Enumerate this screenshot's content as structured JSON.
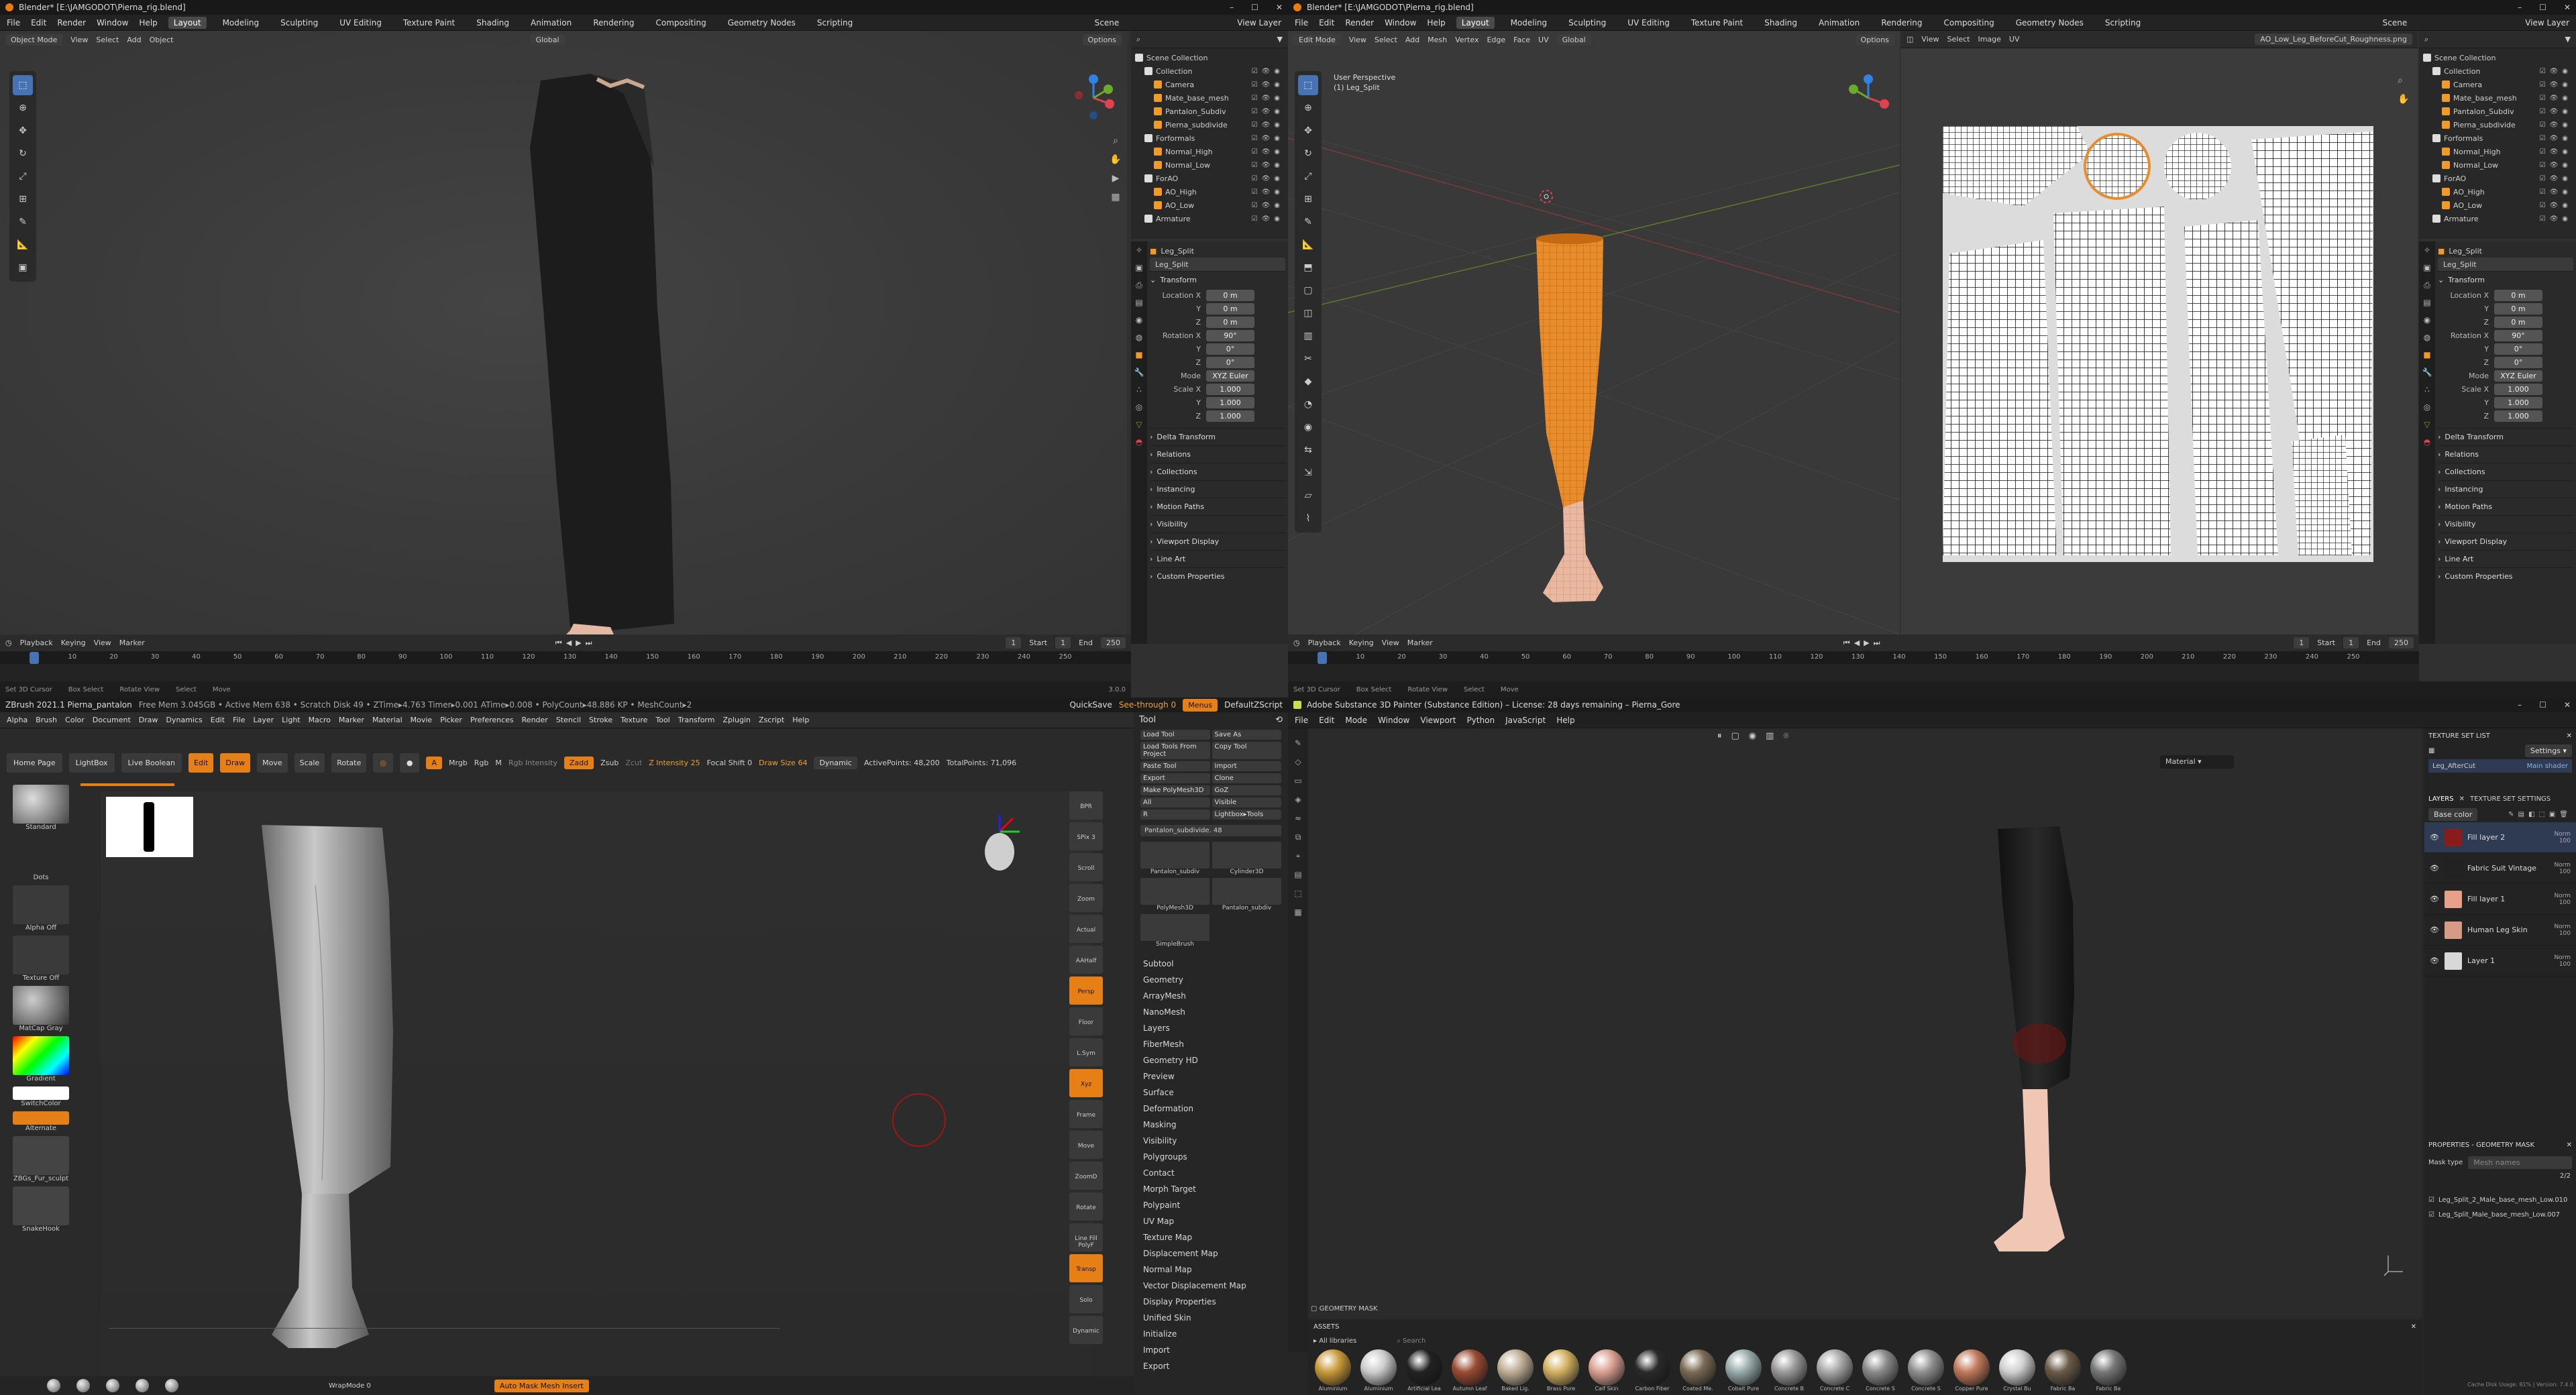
{
  "blender_left": {
    "title": "Blender* [E:\\JAMGODOT\\Pierna_rig.blend]",
    "menu": [
      "File",
      "Edit",
      "Render",
      "Window",
      "Help"
    ],
    "workspaces": [
      "Layout",
      "Modeling",
      "Sculpting",
      "UV Editing",
      "Texture Paint",
      "Shading",
      "Animation",
      "Rendering",
      "Compositing",
      "Geometry Nodes",
      "Scripting"
    ],
    "active_workspace": "Layout",
    "scene": "Scene",
    "view_layer": "View Layer",
    "mode": "Object Mode",
    "view_menu": [
      "View",
      "Select",
      "Add",
      "Object"
    ],
    "orientation": "Global",
    "options": "Options"
  },
  "outliner": {
    "header": "Scene Collection",
    "items": [
      {
        "label": "Collection",
        "level": 1
      },
      {
        "label": "Camera",
        "level": 2
      },
      {
        "label": "Mate_base_mesh",
        "level": 2
      },
      {
        "label": "Pantalon_Subdiv",
        "level": 2
      },
      {
        "label": "Pierna_subdivide",
        "level": 2
      },
      {
        "label": "Forformals",
        "level": 1
      },
      {
        "label": "Normal_High",
        "level": 2
      },
      {
        "label": "Normal_Low",
        "level": 2
      },
      {
        "label": "ForAO",
        "level": 1
      },
      {
        "label": "AO_High",
        "level": 2
      },
      {
        "label": "AO_Low",
        "level": 2
      },
      {
        "label": "Armature",
        "level": 1
      }
    ]
  },
  "properties": {
    "object": "Leg_Split",
    "data_name": "Leg_Split",
    "transform": "Transform",
    "rows": [
      {
        "label": "Location X",
        "value": "0 m"
      },
      {
        "label": "Y",
        "value": "0 m"
      },
      {
        "label": "Z",
        "value": "0 m"
      },
      {
        "label": "Rotation X",
        "value": "90°"
      },
      {
        "label": "Y",
        "value": "0°"
      },
      {
        "label": "Z",
        "value": "0°"
      },
      {
        "label": "Mode",
        "value": "XYZ Euler"
      },
      {
        "label": "Scale X",
        "value": "1.000"
      },
      {
        "label": "Y",
        "value": "1.000"
      },
      {
        "label": "Z",
        "value": "1.000"
      }
    ],
    "sections": [
      "Delta Transform",
      "Relations",
      "Collections",
      "Instancing",
      "Motion Paths",
      "Visibility",
      "Viewport Display",
      "Line Art",
      "Custom Properties"
    ]
  },
  "timeline": {
    "menu": [
      "Playback",
      "Keying",
      "View",
      "Marker"
    ],
    "frame": "1",
    "start_label": "Start",
    "start": "1",
    "end_label": "End",
    "end": "250",
    "ticks": [
      "10",
      "20",
      "30",
      "40",
      "50",
      "60",
      "70",
      "80",
      "90",
      "100",
      "110",
      "120",
      "130",
      "140",
      "150",
      "160",
      "170",
      "180",
      "190",
      "200",
      "210",
      "220",
      "230",
      "240",
      "250"
    ],
    "status": [
      "Set 3D Cursor",
      "Box Select",
      "Rotate View",
      "Select",
      "Move"
    ],
    "version": "3.0.0"
  },
  "blender_right": {
    "mode": "Edit Mode",
    "view_menu": [
      "View",
      "Select",
      "Add",
      "Mesh",
      "Vertex",
      "Edge",
      "Face",
      "UV"
    ],
    "viewport_label": "User Perspective",
    "viewport_obj": "(1) Leg_Split",
    "uv_menu": [
      "View",
      "Select",
      "Image",
      "UV"
    ],
    "image_name": "AO_Low_Leg_BeforeCut_Roughness.png"
  },
  "zbrush": {
    "title": "ZBrush 2021.1   Pierna_pantalon",
    "stats": "Free Mem 3.045GB • Active Mem 638 • Scratch Disk 49 • ZTime▸4.763 Timer▸0.001 ATime▸0.008 • PolyCount▸48.886 KP • MeshCount▸2",
    "quicksave": "QuickSave",
    "seethrough": "See-through 0",
    "menus_btn": "Menus",
    "script": "DefaultZScript",
    "menu": [
      "Alpha",
      "Brush",
      "Color",
      "Document",
      "Draw",
      "Dynamics",
      "Edit",
      "File",
      "Layer",
      "Light",
      "Macro",
      "Marker",
      "Material",
      "Movie",
      "Picker",
      "Preferences",
      "Render",
      "Stencil",
      "Stroke",
      "Texture",
      "Tool",
      "Transform",
      "Zplugin",
      "Zscript",
      "Help"
    ],
    "top_btns": [
      "Home Page",
      "LightBox",
      "Live Boolean"
    ],
    "modes": [
      "Edit",
      "Draw",
      "Move",
      "Scale",
      "Rotate"
    ],
    "a_label": "A",
    "mrgb": "Mrgb",
    "rgb": "Rgb",
    "m": "M",
    "rgb_int": "Rgb Intensity",
    "zadd": "Zadd",
    "zsub": "Zsub",
    "zcut": "Zcut",
    "zint": "Z Intensity 25",
    "focal": "Focal Shift 0",
    "draw_size": "Draw Size 64",
    "dynamic": "Dynamic",
    "active_pts": "ActivePoints: 48,200",
    "total_pts": "TotalPoints: 71,096",
    "left_labels": [
      "Standard",
      "Dots",
      "Alpha Off",
      "Texture Off",
      "MatCap Gray",
      "Gradient",
      "SwitchColor",
      "Alternate",
      "ZBGs_Fur_sculpt",
      "SnakeHook"
    ],
    "right_labels": [
      "BPR",
      "SPix 3",
      "Scroll",
      "Zoom",
      "Actual",
      "AAHalf",
      "Persp",
      "Floor",
      "L.Sym",
      "Xyz",
      "Frame",
      "Move",
      "ZoomD",
      "Rotate",
      "Line Fill PolyF",
      "Transp",
      "Solo",
      "Dynamic"
    ],
    "tool_title": "Tool",
    "tool_btns": [
      "Load Tool",
      "Save As",
      "Load Tools From Project",
      "Copy Tool",
      "Paste Tool",
      "Import",
      "Export",
      "Clone",
      "Make PolyMesh3D",
      "GoZ",
      "All",
      "Visible",
      "R",
      "Lightbox▸Tools"
    ],
    "subtool_name": "Pantalon_subdivide. 48",
    "thumbs": [
      "Pantalon_subdiv",
      "Cylinder3D",
      "PolyMesh3D",
      "Pantalon_subdiv",
      "SimpleBrush"
    ],
    "tool_menu": [
      "Subtool",
      "Geometry",
      "ArrayMesh",
      "NanoMesh",
      "Layers",
      "FiberMesh",
      "Geometry HD",
      "Preview",
      "Surface",
      "Deformation",
      "Masking",
      "Visibility",
      "Polygroups",
      "Contact",
      "Morph Target",
      "Polypaint",
      "UV Map",
      "Texture Map",
      "Displacement Map",
      "Normal Map",
      "Vector Displacement Map",
      "Display Properties",
      "Unified Skin",
      "Initialize",
      "Import",
      "Export"
    ],
    "bottom": [
      "WrapMode 0",
      "Auto Mask Mesh Insert"
    ]
  },
  "painter": {
    "title": "Adobe Substance 3D Painter (Substance Edition) – License: 28 days remaining – Pierna_Gore",
    "menu": [
      "File",
      "Edit",
      "Mode",
      "Window",
      "Viewport",
      "Python",
      "JavaScript",
      "Help"
    ],
    "material": "Material",
    "tsl_title": "TEXTURE SET LIST",
    "settings": "Settings ▾",
    "texture_set": "Leg_AfterCut",
    "main_shader": "Main shader",
    "tabs": [
      "LAYERS",
      "TEXTURE SET SETTINGS"
    ],
    "channel": "Base color",
    "layers": [
      {
        "name": "Fill layer 2",
        "blend": "Norm",
        "op": "100",
        "color": "#8a1b1b"
      },
      {
        "name": "Fabric Suit Vintage",
        "blend": "Norm",
        "op": "100",
        "color": "#222222"
      },
      {
        "name": "Fill layer 1",
        "blend": "Norm",
        "op": "100",
        "color": "#e8a08a"
      },
      {
        "name": "Human Leg Skin",
        "blend": "Norm",
        "op": "100",
        "color": "#d79a86"
      },
      {
        "name": "Layer 1",
        "blend": "Norm",
        "op": "100",
        "color": "#d8d8d8"
      }
    ],
    "props_title": "PROPERTIES - GEOMETRY MASK",
    "mask_type": "Mask type",
    "mask_val": "Mesh names",
    "mask_count": "2/2",
    "mask_items": [
      "Leg_Split_2_Male_base_mesh_Low.010",
      "Leg_Split_Male_base_mesh_Low.007"
    ],
    "geo_mask": "GEOMETRY MASK",
    "assets": "ASSETS",
    "all_libraries": "All libraries",
    "search": "Search",
    "asset_names": [
      "Aluminium",
      "Aluminium",
      "Artificial Lea",
      "Autumn Leaf",
      "Baked Lig.",
      "Brass Pure",
      "Calf Skin",
      "Carbon Fiber",
      "Coated Me.",
      "Cobalt Pure",
      "Concrete B",
      "Concrete C",
      "Concrete S",
      "Concrete S",
      "Copper Pure",
      "Crystal Bu",
      "Fabric Ba",
      "Fabric Ba"
    ],
    "status": "Cache Disk Usage: 81% | Version: 7.4.0"
  },
  "colors": {
    "blender_bg": "#3d3d3d",
    "selected_orange": "#f09a2a",
    "zbrush_orange": "#e77f17",
    "active_blue": "#4772b3"
  }
}
